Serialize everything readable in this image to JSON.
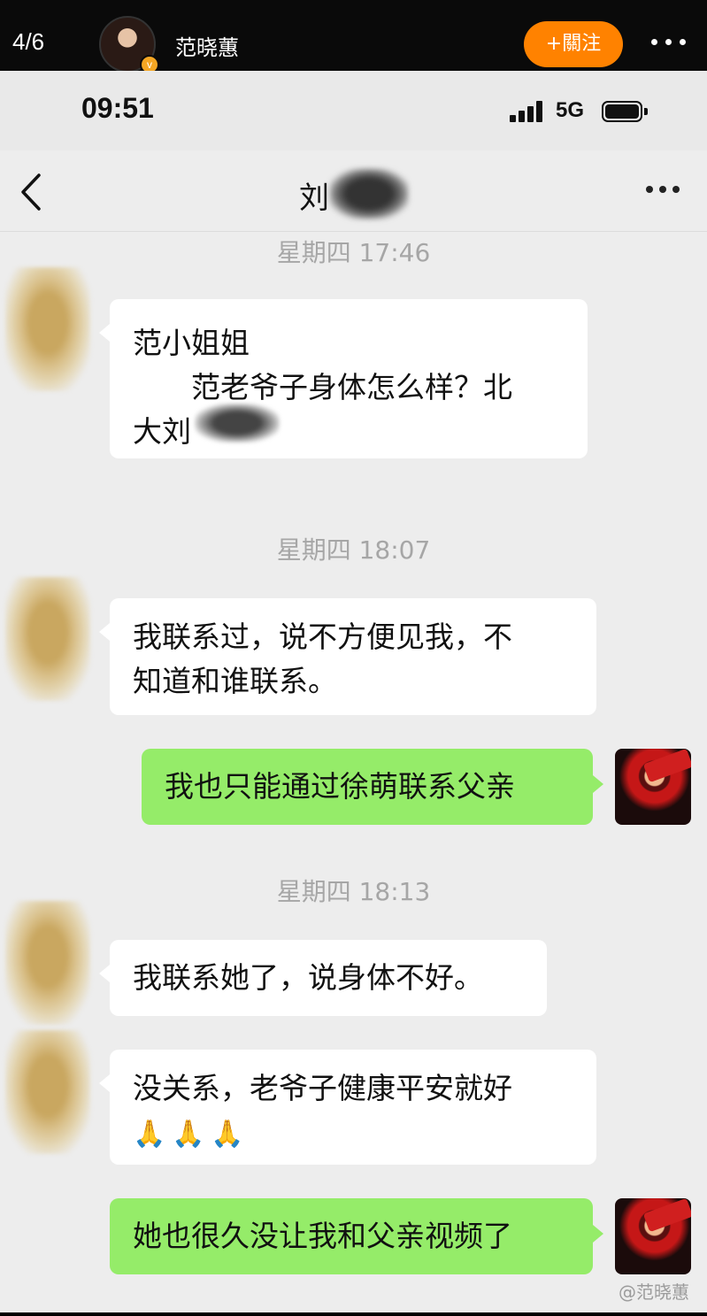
{
  "weibo": {
    "counter": "4/6",
    "username": "范晓蕙",
    "verified_badge": "v",
    "follow_label": "+關注",
    "more_icon": "more-dots-icon"
  },
  "status_bar": {
    "time": "09:51",
    "network": "5G",
    "battery_level": 1.0
  },
  "chat": {
    "title": "刘",
    "title_redacted": true,
    "back_icon": "chevron-left-icon",
    "more_icon": "more-dots-icon",
    "messages": [
      {
        "type": "timestamp",
        "text": "星期四 17:46"
      },
      {
        "type": "incoming",
        "lines": [
          "范小姐姐",
          "范老爷子身体怎么样？北",
          "大刘"
        ],
        "redacted_tail": true
      },
      {
        "type": "timestamp",
        "text": "星期四 18:07"
      },
      {
        "type": "incoming",
        "lines": [
          "我联系过，说不方便见我，不",
          "知道和谁联系。"
        ]
      },
      {
        "type": "outgoing",
        "lines": [
          "我也只能通过徐萌联系父亲"
        ]
      },
      {
        "type": "timestamp",
        "text": "星期四 18:13"
      },
      {
        "type": "incoming",
        "lines": [
          "我联系她了，说身体不好。"
        ]
      },
      {
        "type": "incoming",
        "lines": [
          "没关系，老爷子健康平安就好"
        ],
        "emoji": [
          "🙏",
          "🙏",
          "🙏"
        ]
      },
      {
        "type": "outgoing",
        "lines": [
          "她也很久没让我和父亲视频了"
        ]
      }
    ]
  },
  "watermark": "@范晓蕙"
}
